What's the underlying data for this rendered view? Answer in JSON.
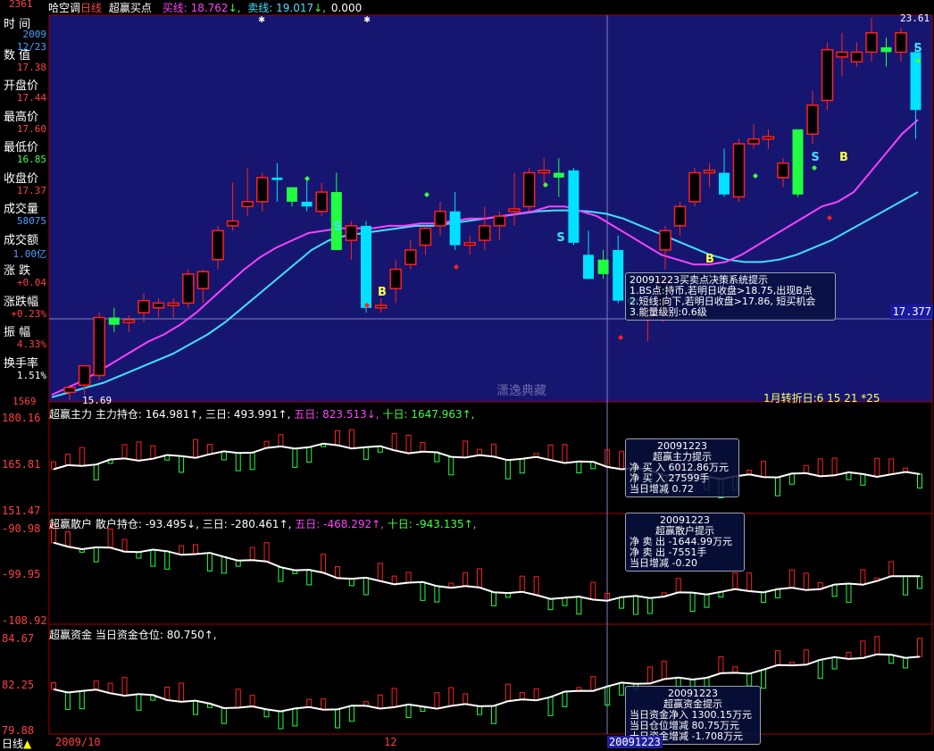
{
  "title_bar": {
    "stock_name": "哈空调",
    "period": "日线",
    "indicator": "超赢买点",
    "buy_line_label": "买线:",
    "buy_line_value": "18.762",
    "sell_line_label": "卖线:",
    "sell_line_value": "19.017",
    "extra_value": "0.000"
  },
  "sidebar": [
    {
      "label": "时  间",
      "value": "2009",
      "value2": "12/23",
      "color": "#4aa0ff"
    },
    {
      "label": "数  值",
      "value": "17.38",
      "color": "#ff4040"
    },
    {
      "label": "开盘价",
      "value": "17.44",
      "color": "#ff4040"
    },
    {
      "label": "最高价",
      "value": "17.60",
      "color": "#ff4040"
    },
    {
      "label": "最低价",
      "value": "16.85",
      "color": "#40ff40"
    },
    {
      "label": "收盘价",
      "value": "17.37",
      "color": "#ff4040"
    },
    {
      "label": "成交量",
      "value": "58075",
      "color": "#4aa0ff"
    },
    {
      "label": "成交额",
      "value": "1.00亿",
      "color": "#4aa0ff"
    },
    {
      "label": "涨  跌",
      "value": "+0.04",
      "color": "#ff4040"
    },
    {
      "label": "涨跌幅",
      "value": "+0.23%",
      "color": "#ff4040"
    },
    {
      "label": "振  幅",
      "value": "4.33%",
      "color": "#ff4040"
    },
    {
      "label": "换手率",
      "value": "1.51%",
      "color": "#ffffff"
    }
  ],
  "main_chart": {
    "high_label": "23.61",
    "low_label": "15.69",
    "top_axis_label": "2361",
    "bottom_axis_label": "1569",
    "cursor_price": "17.377",
    "watermark": "潇逸典藏",
    "turning_date": "1月转折日:6 15 21 *25",
    "tooltip_title": "20091223买卖点决策系统提示",
    "tooltip_lines": [
      "1.BS点:持币,若明日收盘>18.75,出现B点",
      "2.短线:向下,若明日收盘>17.86, 短买机会",
      "3.能量级别:0.6级"
    ],
    "signal_buy": "B",
    "signal_sell": "S"
  },
  "pane1": {
    "legend_title": "超赢主力",
    "legend_label": "主力持仓:",
    "legend_value": "164.981↑,",
    "d3_label": "三日:",
    "d3_value": "493.991↑,",
    "d5_label": "五日:",
    "d5_value": "823.513↓,",
    "d10_label": "十日:",
    "d10_value": "1647.963↑,",
    "y_top": "180.16",
    "y_mid": "165.81",
    "y_bot": "151.47",
    "tooltip": [
      "20091223",
      "超赢主力提示",
      "净 买 入 6012.86万元",
      "净 买 入 27599手",
      "当日增减 0.72"
    ]
  },
  "pane2": {
    "legend_title": "超赢散户",
    "legend_label": "散户持仓:",
    "legend_value": "-93.495↓,",
    "d3_label": "三日:",
    "d3_value": "-280.461↑,",
    "d5_label": "五日:",
    "d5_value": "-468.292↑,",
    "d10_label": "十日:",
    "d10_value": "-943.135↑,",
    "y_top": "-90.98",
    "y_mid": "-99.95",
    "y_bot": "-108.92",
    "tooltip": [
      "20091223",
      "超赢散户提示",
      "净 卖 出 -1644.99万元",
      "净 卖 出 -7551手",
      "当日增减 -0.20"
    ]
  },
  "pane3": {
    "legend_title": "超赢资金",
    "legend_label": "当日资金仓位:",
    "legend_value": "80.750↑,",
    "y_top": "84.67",
    "y_mid": "82.25",
    "y_bot": "79.88",
    "tooltip": [
      "20091223",
      "超赢资金提示",
      "当日资金净入 1300.15万元",
      "当日仓位增减 80.75万元",
      "十日资金增减 -1.708万元"
    ]
  },
  "bottom_bar": {
    "period_label": "日线",
    "date_start": "2009/10",
    "date_mid": "12",
    "date_cursor": "20091223"
  },
  "colors": {
    "up": "#ff2020",
    "down_main": "#00e0ff",
    "green": "#20ff40",
    "buy_line": "#ff40ff",
    "sell_line": "#40e0ff",
    "main_bg": "#161670",
    "grid": "#a00000"
  },
  "chart_data": {
    "type": "candlestick",
    "ylim": [
      15.69,
      23.61
    ],
    "candles": [
      {
        "o": 15.85,
        "h": 16.0,
        "l": 15.69,
        "c": 15.95
      },
      {
        "o": 16.0,
        "h": 16.3,
        "l": 15.8,
        "c": 16.4
      },
      {
        "o": 16.2,
        "h": 17.5,
        "l": 16.1,
        "c": 17.4
      },
      {
        "o": 17.4,
        "h": 17.6,
        "l": 17.1,
        "c": 17.25
      },
      {
        "o": 17.3,
        "h": 17.45,
        "l": 17.1,
        "c": 17.35
      },
      {
        "o": 17.5,
        "h": 17.9,
        "l": 17.3,
        "c": 17.75
      },
      {
        "o": 17.6,
        "h": 17.8,
        "l": 17.4,
        "c": 17.7
      },
      {
        "o": 17.65,
        "h": 17.8,
        "l": 17.4,
        "c": 17.7
      },
      {
        "o": 17.7,
        "h": 18.4,
        "l": 17.6,
        "c": 18.3
      },
      {
        "o": 18.0,
        "h": 18.4,
        "l": 17.7,
        "c": 18.35
      },
      {
        "o": 18.6,
        "h": 19.3,
        "l": 18.4,
        "c": 19.2
      },
      {
        "o": 19.3,
        "h": 20.2,
        "l": 19.2,
        "c": 19.4
      },
      {
        "o": 19.7,
        "h": 20.5,
        "l": 19.5,
        "c": 19.8
      },
      {
        "o": 19.8,
        "h": 20.4,
        "l": 19.6,
        "c": 20.3
      },
      {
        "o": 20.3,
        "h": 20.6,
        "l": 19.8,
        "c": 20.25
      },
      {
        "o": 20.1,
        "h": 20.1,
        "l": 19.7,
        "c": 19.8
      },
      {
        "o": 19.8,
        "h": 20.3,
        "l": 19.6,
        "c": 19.7
      },
      {
        "o": 19.6,
        "h": 20.2,
        "l": 19.5,
        "c": 20.0
      },
      {
        "o": 20.0,
        "h": 20.4,
        "l": 18.8,
        "c": 18.8
      },
      {
        "o": 19.0,
        "h": 19.4,
        "l": 18.6,
        "c": 19.3
      },
      {
        "o": 19.3,
        "h": 19.4,
        "l": 17.5,
        "c": 17.6
      },
      {
        "o": 17.6,
        "h": 17.8,
        "l": 17.5,
        "c": 17.65
      },
      {
        "o": 18.0,
        "h": 18.6,
        "l": 17.7,
        "c": 18.4
      },
      {
        "o": 18.5,
        "h": 19.0,
        "l": 18.4,
        "c": 18.8
      },
      {
        "o": 18.9,
        "h": 19.3,
        "l": 18.7,
        "c": 19.25
      },
      {
        "o": 19.3,
        "h": 19.8,
        "l": 19.1,
        "c": 19.6
      },
      {
        "o": 19.6,
        "h": 20.0,
        "l": 18.8,
        "c": 18.9
      },
      {
        "o": 18.9,
        "h": 19.1,
        "l": 18.7,
        "c": 18.95
      },
      {
        "o": 19.0,
        "h": 19.7,
        "l": 18.8,
        "c": 19.3
      },
      {
        "o": 19.3,
        "h": 19.6,
        "l": 19.0,
        "c": 19.5
      },
      {
        "o": 19.6,
        "h": 20.4,
        "l": 19.3,
        "c": 19.65
      },
      {
        "o": 19.7,
        "h": 20.5,
        "l": 19.6,
        "c": 20.4
      },
      {
        "o": 20.4,
        "h": 20.7,
        "l": 20.1,
        "c": 20.45
      },
      {
        "o": 20.4,
        "h": 20.7,
        "l": 19.9,
        "c": 20.3
      },
      {
        "o": 20.45,
        "h": 20.5,
        "l": 18.9,
        "c": 18.95
      },
      {
        "o": 18.7,
        "h": 19.2,
        "l": 18.2,
        "c": 18.2
      },
      {
        "o": 18.6,
        "h": 18.8,
        "l": 18.2,
        "c": 18.3
      },
      {
        "o": 18.8,
        "h": 19.1,
        "l": 17.7,
        "c": 17.75
      },
      {
        "o": 17.8,
        "h": 18.2,
        "l": 17.4,
        "c": 17.7
      },
      {
        "o": 17.4,
        "h": 17.8,
        "l": 16.9,
        "c": 17.55
      },
      {
        "o": 17.5,
        "h": 18.2,
        "l": 17.3,
        "c": 18.2
      }
    ],
    "candles_right": [
      {
        "o": 18.8,
        "h": 19.3,
        "l": 18.4,
        "c": 19.2
      },
      {
        "o": 19.3,
        "h": 19.8,
        "l": 19.1,
        "c": 19.7
      },
      {
        "o": 19.8,
        "h": 20.5,
        "l": 19.7,
        "c": 20.4
      },
      {
        "o": 20.4,
        "h": 20.6,
        "l": 20.1,
        "c": 20.45
      },
      {
        "o": 20.4,
        "h": 20.9,
        "l": 19.9,
        "c": 19.95
      },
      {
        "o": 19.9,
        "h": 21.1,
        "l": 19.8,
        "c": 21.0
      },
      {
        "o": 21.0,
        "h": 21.4,
        "l": 20.9,
        "c": 21.1
      },
      {
        "o": 21.1,
        "h": 21.3,
        "l": 20.9,
        "c": 21.15
      },
      {
        "o": 20.3,
        "h": 20.7,
        "l": 20.1,
        "c": 20.6
      },
      {
        "o": 21.3,
        "h": 21.3,
        "l": 19.9,
        "c": 19.95
      },
      {
        "o": 21.2,
        "h": 22.1,
        "l": 21.0,
        "c": 21.8
      },
      {
        "o": 21.9,
        "h": 23.1,
        "l": 21.7,
        "c": 22.95
      },
      {
        "o": 22.8,
        "h": 23.3,
        "l": 22.4,
        "c": 22.9
      },
      {
        "o": 22.7,
        "h": 23.1,
        "l": 22.6,
        "c": 22.9
      },
      {
        "o": 22.9,
        "h": 23.61,
        "l": 22.7,
        "c": 23.3
      },
      {
        "o": 23.0,
        "h": 23.2,
        "l": 22.6,
        "c": 22.9
      },
      {
        "o": 22.9,
        "h": 23.4,
        "l": 22.7,
        "c": 23.3
      },
      {
        "o": 22.9,
        "h": 23.1,
        "l": 21.1,
        "c": 21.7
      }
    ],
    "buy_line": [
      15.8,
      15.95,
      16.1,
      16.3,
      16.5,
      16.7,
      16.9,
      17.05,
      17.25,
      17.5,
      17.8,
      18.1,
      18.4,
      18.65,
      18.85,
      19.0,
      19.15,
      19.2,
      19.25,
      19.25,
      19.25,
      19.3,
      19.3,
      19.35,
      19.35,
      19.4,
      19.45,
      19.45,
      19.5,
      19.55,
      19.6,
      19.7,
      19.7,
      19.6,
      19.5,
      19.3,
      19.1,
      18.9,
      18.7,
      18.6,
      18.5,
      18.5,
      18.55,
      18.7,
      18.9,
      19.1,
      19.3,
      19.5,
      19.7,
      19.8,
      20.0,
      20.4,
      20.8,
      21.2,
      21.5
    ],
    "sell_line": [
      15.75,
      15.85,
      15.95,
      16.05,
      16.2,
      16.35,
      16.5,
      16.65,
      16.85,
      17.05,
      17.3,
      17.6,
      17.9,
      18.2,
      18.5,
      18.8,
      19.0,
      19.1,
      19.15,
      19.2,
      19.25,
      19.3,
      19.3,
      19.35,
      19.4,
      19.45,
      19.5,
      19.55,
      19.6,
      19.62,
      19.62,
      19.6,
      19.55,
      19.45,
      19.3,
      19.15,
      19.0,
      18.85,
      18.7,
      18.6,
      18.55,
      18.55,
      18.6,
      18.7,
      18.85,
      19.0,
      19.2,
      19.4,
      19.6,
      19.8,
      20.0
    ]
  }
}
